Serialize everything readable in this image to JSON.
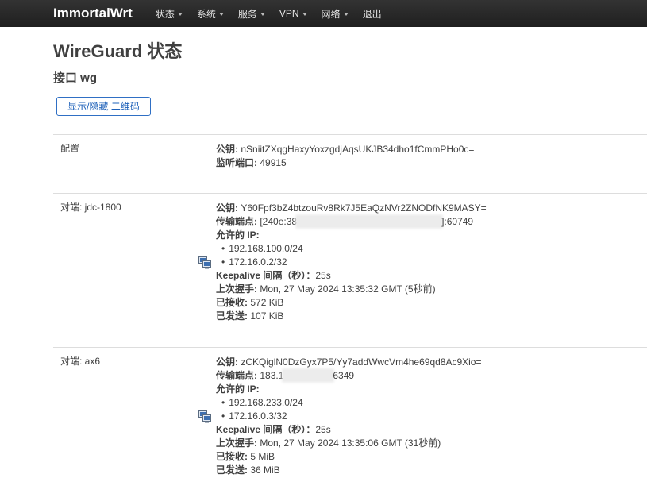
{
  "theme": {
    "navbar_bg": "#222222",
    "accent": "#1d60b9",
    "text": "#404040"
  },
  "nav": {
    "brand": "ImmortalWrt",
    "items": [
      {
        "label": "状态"
      },
      {
        "label": "系统"
      },
      {
        "label": "服务"
      },
      {
        "label": "VPN"
      },
      {
        "label": "网络"
      },
      {
        "label": "退出"
      }
    ]
  },
  "header": {
    "title": "WireGuard 状态",
    "interface": "接口 wg",
    "qr_toggle_label": "显示/隐藏 二维码"
  },
  "labels": {
    "public_key": "公钥:",
    "listen_port": "监听端口:",
    "endpoint": "传输端点:",
    "allowed_ips": "允许的 IP:",
    "keepalive": "Keepalive 间隔（秒）：",
    "last_handshake": "上次握手:",
    "received": "已接收:",
    "sent": "已发送:"
  },
  "config": {
    "label": "配置",
    "public_key": "nSniitZXqgHaxyYoxzgdjAqsUKJB34dho1fCmmPHo0c=",
    "listen_port": "49915"
  },
  "peers": [
    {
      "label": "对端: jdc-1800",
      "icon": "network-icon",
      "public_key": "Y60Fpf3bZ4btzouRv8Rk7J5EaQzNVr2ZNODfNK9MASY=",
      "endpoint_visible_start": "[240e:38",
      "endpoint_visible_end": "]:60749",
      "allowed_ips": [
        "192.168.100.0/24",
        "172.16.0.2/32"
      ],
      "keepalive": "25s",
      "last_handshake": "Mon, 27 May 2024 13:35:32 GMT (5秒前)",
      "received": "572 KiB",
      "sent": "107 KiB"
    },
    {
      "label": "对端: ax6",
      "icon": "network-icon",
      "public_key": "zCKQiglN0DzGyx7P5/Yy7addWwcVm4he69qd8Ac9Xio=",
      "endpoint_visible_start": "183.1",
      "endpoint_visible_end": "6349",
      "allowed_ips": [
        "192.168.233.0/24",
        "172.16.0.3/32"
      ],
      "keepalive": "25s",
      "last_handshake": "Mon, 27 May 2024 13:35:06 GMT (31秒前)",
      "received": "5 MiB",
      "sent": "36 MiB"
    }
  ]
}
